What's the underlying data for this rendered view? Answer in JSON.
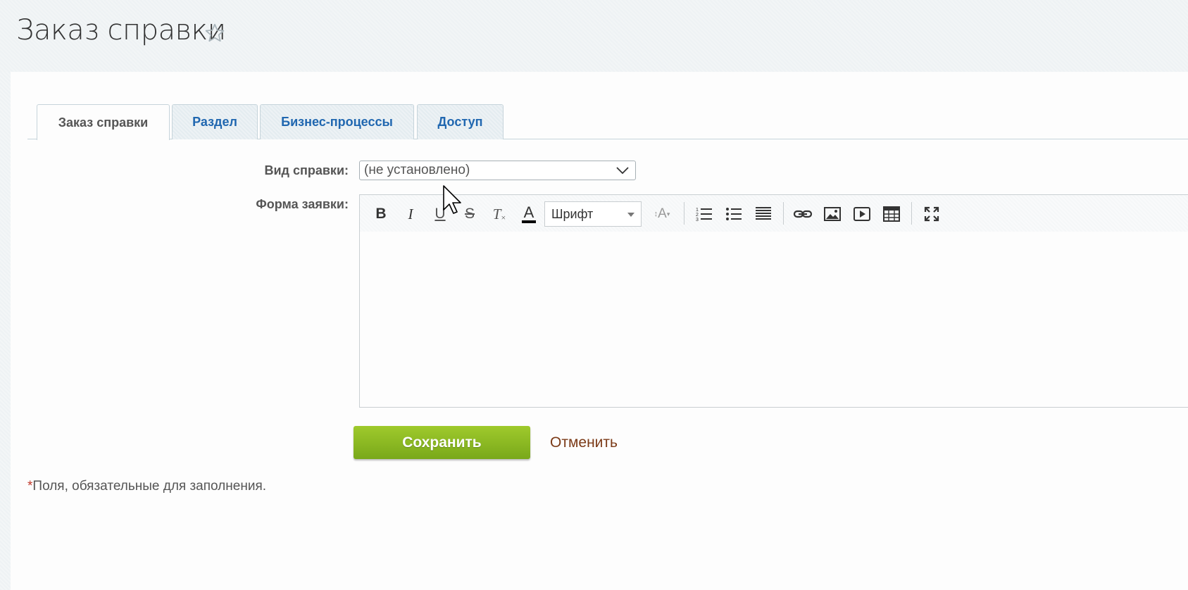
{
  "page": {
    "title": "Заказ справки"
  },
  "tabs": [
    {
      "label": "Заказ справки",
      "active": true
    },
    {
      "label": "Раздел",
      "active": false
    },
    {
      "label": "Бизнес-процессы",
      "active": false
    },
    {
      "label": "Доступ",
      "active": false
    }
  ],
  "form": {
    "type_label": "Вид справки:",
    "type_value": "(не установлено)",
    "request_label": "Форма заявки:",
    "editor": {
      "toolbar": {
        "bold": "B",
        "italic": "I",
        "underline": "U",
        "strike": "S",
        "clear_format": "T",
        "font_color": "A",
        "font_select": "Шрифт",
        "font_size_icon": "A"
      },
      "content": ""
    }
  },
  "buttons": {
    "save": "Сохранить",
    "cancel": "Отменить"
  },
  "footer": {
    "asterisk": "*",
    "required_note": "Поля, обязательные для заполнения."
  },
  "colors": {
    "tab_link": "#2067b0",
    "save_green": "#8bbb22",
    "cancel_link": "#7b3a17",
    "required_red": "#c0392b"
  }
}
